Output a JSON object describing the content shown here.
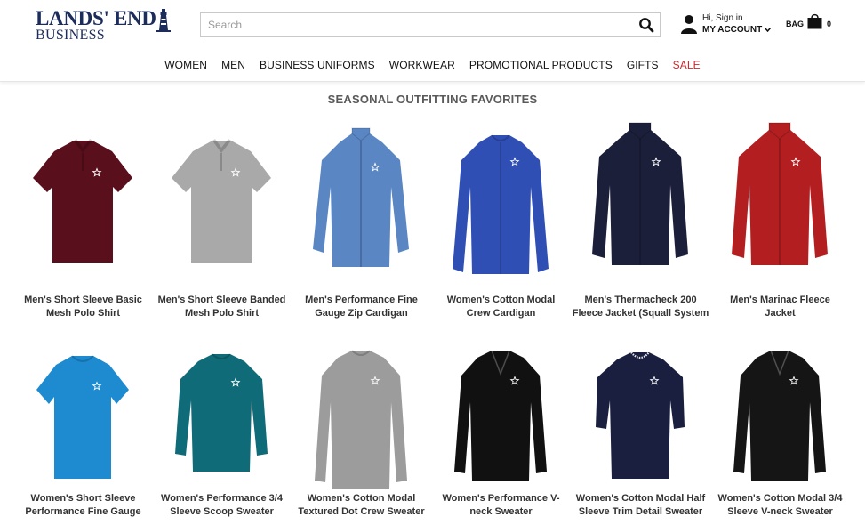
{
  "header": {
    "logo": {
      "brand": "LANDS' END",
      "sub": "BUSINESS"
    },
    "search": {
      "placeholder": "Search"
    },
    "account": {
      "greeting": "Hi, Sign in",
      "label": "MY ACCOUNT"
    },
    "bag": {
      "label": "BAG",
      "count": "0"
    }
  },
  "nav": {
    "items": [
      {
        "label": "WOMEN"
      },
      {
        "label": "MEN"
      },
      {
        "label": "BUSINESS UNIFORMS"
      },
      {
        "label": "WORKWEAR"
      },
      {
        "label": "PROMOTIONAL PRODUCTS"
      },
      {
        "label": "GIFTS"
      },
      {
        "label": "SALE"
      }
    ],
    "sale_color": "#d0242a"
  },
  "section": {
    "title": "SEASONAL OUTFITTING FAVORITES"
  },
  "products": [
    {
      "line1": "Men's Short Sleeve Basic",
      "line2": "Mesh Polo Shirt",
      "color": "#5a0f1c",
      "style": "polo",
      "icon": "polo-shirt-icon"
    },
    {
      "line1": "Men's Short Sleeve Banded",
      "line2": "Mesh Polo Shirt",
      "color": "#a9a9a9",
      "style": "polo",
      "icon": "polo-shirt-icon"
    },
    {
      "line1": "Men's Performance Fine",
      "line2": "Gauge Zip Cardigan",
      "color": "#5a86c4",
      "style": "zip",
      "icon": "zip-cardigan-icon"
    },
    {
      "line1": "Women's Cotton Modal",
      "line2": "Crew Cardigan",
      "color": "#2f4fb5",
      "style": "cardigan",
      "icon": "cardigan-icon"
    },
    {
      "line1": "Men's Thermacheck 200",
      "line2": "Fleece Jacket (Squall System",
      "color": "#1b1f3a",
      "style": "jacket",
      "icon": "fleece-jacket-icon"
    },
    {
      "line1": "Men's Marinac Fleece",
      "line2": "Jacket",
      "color": "#b31f21",
      "style": "jacket",
      "icon": "fleece-jacket-icon"
    },
    {
      "line1": "Women's Short Sleeve",
      "line2": "Performance Fine Gauge",
      "color": "#1e8ad0",
      "style": "tee",
      "icon": "short-sleeve-sweater-icon"
    },
    {
      "line1": "Women's Performance 3/4",
      "line2": "Sleeve Scoop Sweater",
      "color": "#0f6b78",
      "style": "threequarter",
      "icon": "scoop-sweater-icon"
    },
    {
      "line1": "Women's Cotton Modal",
      "line2": "Textured Dot Crew Sweater",
      "color": "#9c9c9c",
      "style": "longsleeve",
      "icon": "crew-sweater-icon"
    },
    {
      "line1": "Women's Performance V-",
      "line2": "neck Sweater",
      "color": "#111111",
      "style": "vneck",
      "icon": "v-neck-sweater-icon"
    },
    {
      "line1": "Women's Cotton Modal Half",
      "line2": "Sleeve Trim Detail Sweater",
      "color": "#1a1f3f",
      "style": "halfsleeve",
      "icon": "half-sleeve-sweater-icon"
    },
    {
      "line1": "Women's Cotton Modal 3/4",
      "line2": "Sleeve V-neck Sweater",
      "color": "#151515",
      "style": "vneck",
      "icon": "v-neck-sweater-icon"
    }
  ],
  "colors": {
    "brand": "#1c2c5b",
    "title": "#5a5a5a"
  }
}
